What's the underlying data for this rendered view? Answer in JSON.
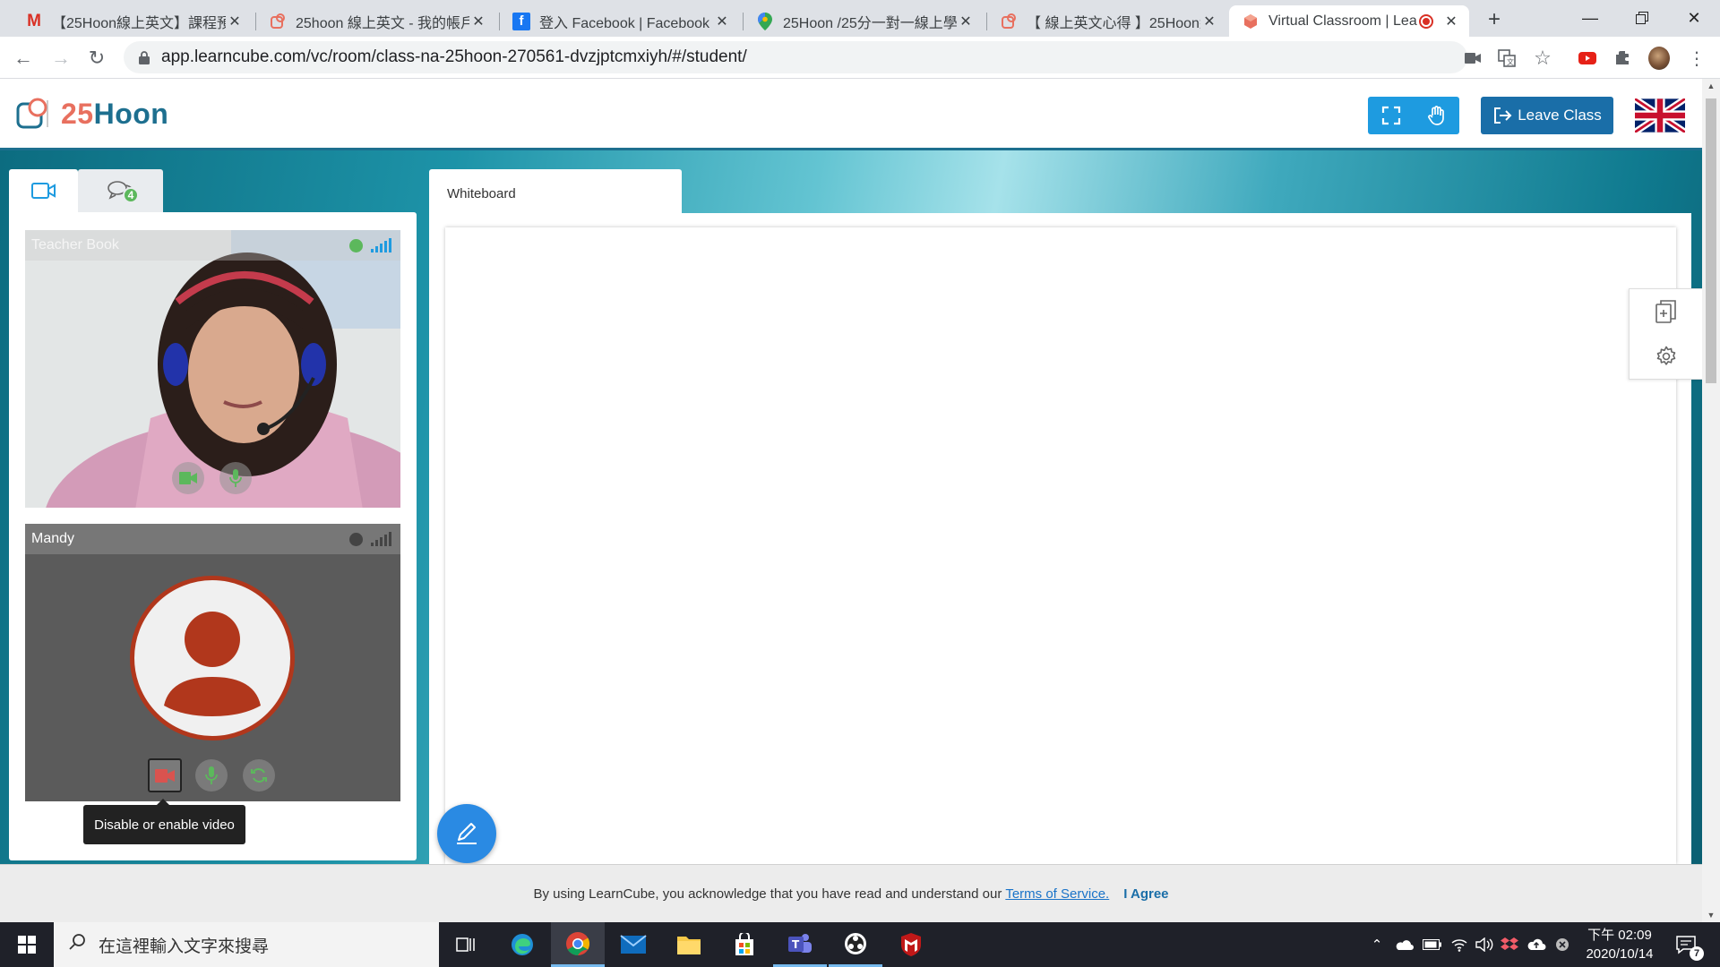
{
  "browser": {
    "tabs": [
      {
        "title": "【25Hoon線上英文】課程預",
        "icon": "gmail-icon"
      },
      {
        "title": "25hoon 線上英文 - 我的帳戶",
        "icon": "25hoon-logo-icon"
      },
      {
        "title": "登入 Facebook | Facebook",
        "icon": "facebook-icon"
      },
      {
        "title": "25Hoon /25分一對一線上學",
        "icon": "maps-pin-icon"
      },
      {
        "title": "【 線上英文心得 】25Hoon線",
        "icon": "25hoon-logo-icon"
      },
      {
        "title": "Virtual Classroom | Lea",
        "icon": "learncube-icon",
        "active": true,
        "recording": true
      }
    ],
    "url": "app.learncube.com/vc/room/class-na-25hoon-270561-dvzjptcmxiyh/#/student/"
  },
  "app": {
    "logo_text_a": "25",
    "logo_text_b": "Hoon",
    "leave_label": "Leave Class",
    "accent_color": "#1a6ea8",
    "chat_badge": "4"
  },
  "video": {
    "teacher_name": "Teacher Book",
    "teacher_status": "online",
    "student_name": "Mandy",
    "student_status": "offline",
    "tooltip": "Disable or enable video"
  },
  "whiteboard": {
    "tab_label": "Whiteboard"
  },
  "consent": {
    "text": "By using LearnCube, you acknowledge that you have read and understand our",
    "link": "Terms of Service.",
    "agree": "I Agree"
  },
  "taskbar": {
    "search_placeholder": "在這裡輸入文字來搜尋",
    "time": "下午 02:09",
    "date": "2020/10/14",
    "notification_count": "7"
  }
}
